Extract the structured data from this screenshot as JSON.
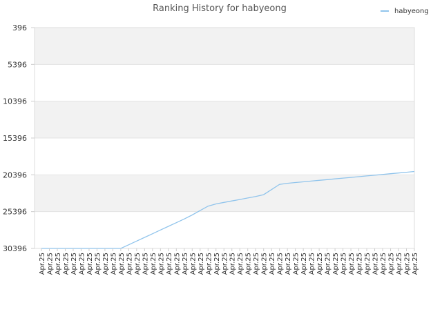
{
  "chart_data": {
    "type": "line",
    "title": "Ranking History for habyeong",
    "xlabel": "",
    "ylabel": "",
    "y_inverted": true,
    "ylim": [
      396,
      30396
    ],
    "y_ticks": [
      "396",
      "5396",
      "10396",
      "15396",
      "20396",
      "25396",
      "30396"
    ],
    "y_tick_values": [
      396,
      5396,
      10396,
      15396,
      20396,
      25396,
      30396
    ],
    "grid": true,
    "band_color": "#f2f2f2",
    "legend_position": "top-right",
    "categories": [
      "Apr.25",
      "Apr.25",
      "Apr.25",
      "Apr.25",
      "Apr.25",
      "Apr.25",
      "Apr.25",
      "Apr.25",
      "Apr.25",
      "Apr.25",
      "Apr.25",
      "Apr.25",
      "Apr.25",
      "Apr.25",
      "Apr.25",
      "Apr.25",
      "Apr.25",
      "Apr.25",
      "Apr.25",
      "Apr.25",
      "Apr.25",
      "Apr.25",
      "Apr.25",
      "Apr.25",
      "Apr.25",
      "Apr.25",
      "Apr.25",
      "Apr.25",
      "Apr.25",
      "Apr.25",
      "Apr.25",
      "Apr.25",
      "Apr.25",
      "Apr.25",
      "Apr.25",
      "Apr.25",
      "Apr.25",
      "Apr.25",
      "Apr.25",
      "Apr.25",
      "Apr.25",
      "Apr.25",
      "Apr.25",
      "Apr.25",
      "Apr.25",
      "Apr.25",
      "Apr.25",
      "Apr.25"
    ],
    "series": [
      {
        "name": "habyeong",
        "color": "#90c4ec",
        "values": [
          30396,
          30396,
          30396,
          30396,
          30396,
          30396,
          30396,
          30396,
          30396,
          30396,
          30396,
          29896,
          29396,
          28896,
          28396,
          27896,
          27396,
          26896,
          26396,
          25846,
          25246,
          24646,
          24346,
          24146,
          23946,
          23746,
          23546,
          23346,
          23096,
          22396,
          21696,
          21546,
          21446,
          21346,
          21246,
          21146,
          21046,
          20946,
          20846,
          20746,
          20646,
          20546,
          20446,
          20346,
          20246,
          20146,
          20046,
          19946
        ]
      }
    ]
  }
}
